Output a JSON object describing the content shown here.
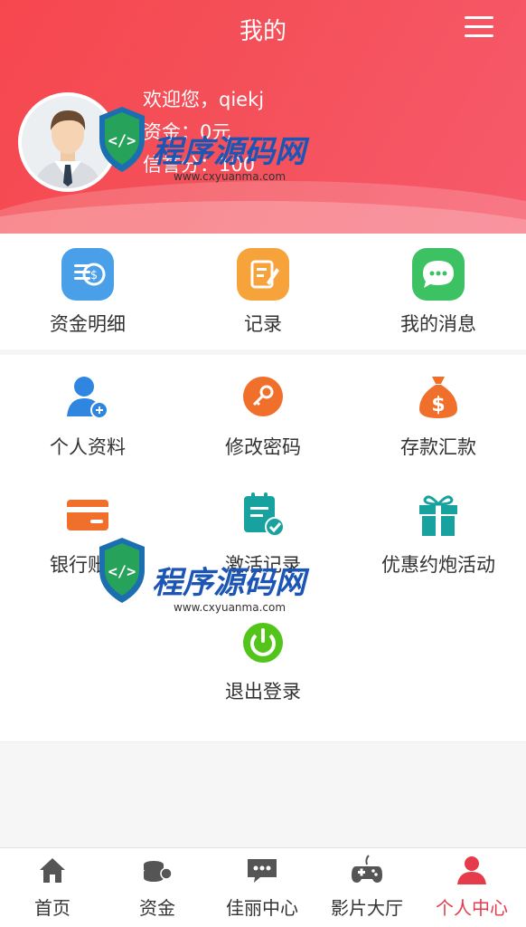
{
  "header": {
    "title": "我的"
  },
  "user": {
    "welcome": "欢迎您，qiekj",
    "balance": "资金：0元",
    "credit": "信誉分：100"
  },
  "grid_top": [
    {
      "label": "资金明细",
      "icon": "money-detail-icon"
    },
    {
      "label": "记录",
      "icon": "record-icon"
    },
    {
      "label": "我的消息",
      "icon": "message-icon"
    }
  ],
  "grid_main": [
    {
      "label": "个人资料",
      "icon": "profile-icon"
    },
    {
      "label": "修改密码",
      "icon": "key-icon"
    },
    {
      "label": "存款汇款",
      "icon": "money-bag-icon"
    },
    {
      "label": "银行账户",
      "icon": "bank-card-icon"
    },
    {
      "label": "激活记录",
      "icon": "activation-record-icon"
    },
    {
      "label": "优惠约炮活动",
      "icon": "gift-icon"
    },
    {
      "label": "退出登录",
      "icon": "power-icon"
    }
  ],
  "tabbar": [
    {
      "label": "首页",
      "icon": "home-icon"
    },
    {
      "label": "资金",
      "icon": "coins-icon"
    },
    {
      "label": "佳丽中心",
      "icon": "chat-icon"
    },
    {
      "label": "影片大厅",
      "icon": "gamepad-icon"
    },
    {
      "label": "个人中心",
      "icon": "user-icon",
      "active": true
    }
  ],
  "watermark": {
    "text_a": "程序",
    "text_b": "源码网",
    "url": "www.cxyuanma.com"
  },
  "colors": {
    "header": "#f4505a",
    "active_tab": "#e53b4b"
  }
}
